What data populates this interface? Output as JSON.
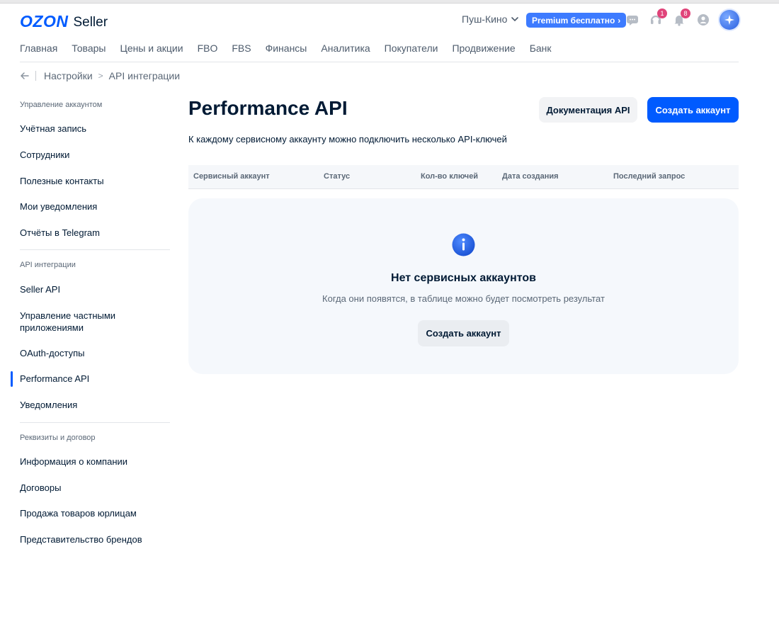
{
  "header": {
    "logo_brand": "OZON",
    "logo_suffix": "Seller",
    "store_name": "Пуш-Кино",
    "premium_label": "Premium бесплатно",
    "support_badge": "1",
    "notifications_badge": "8"
  },
  "nav": {
    "items": [
      "Главная",
      "Товары",
      "Цены и акции",
      "FBO",
      "FBS",
      "Финансы",
      "Аналитика",
      "Покупатели",
      "Продвижение",
      "Банк"
    ]
  },
  "breadcrumb": {
    "items": [
      "Настройки",
      "API интеграции"
    ]
  },
  "sidebar": {
    "groups": [
      {
        "title": "Управление аккаунтом",
        "items": [
          "Учётная запись",
          "Сотрудники",
          "Полезные контакты",
          "Мои уведомления",
          "Отчёты в Telegram"
        ]
      },
      {
        "title": "API интеграции",
        "items": [
          "Seller API",
          "Управление частными приложениями",
          "OAuth-доступы",
          "Performance API",
          "Уведомления"
        ]
      },
      {
        "title": "Реквизиты и договор",
        "items": [
          "Информация о компании",
          "Договоры",
          "Продажа товаров юрлицам",
          "Представительство брендов"
        ]
      }
    ],
    "active_item": "Performance API"
  },
  "main": {
    "title": "Performance API",
    "docs_button": "Документация API",
    "create_button": "Создать аккаунт",
    "subtitle": "К каждому сервисному аккаунту можно подключить несколько API-ключей",
    "table_headers": [
      "Сервисный аккаунт",
      "Статус",
      "Кол-во ключей",
      "Дата создания",
      "Последний запрос"
    ],
    "empty_title": "Нет сервисных аккаунтов",
    "empty_text": "Когда они появятся, в таблице можно будет посмотреть результат",
    "empty_button": "Создать аккаунт"
  },
  "colors": {
    "accent": "#005bff",
    "badge": "#e0447a",
    "text": "#001a34"
  }
}
